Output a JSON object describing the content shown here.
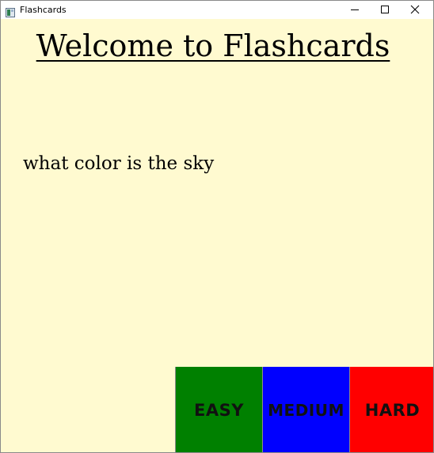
{
  "window": {
    "title": "Flashcards",
    "controls": {
      "minimize_icon": "minimize-icon",
      "maximize_icon": "maximize-icon",
      "close_icon": "close-icon"
    }
  },
  "main": {
    "heading": "Welcome to Flashcards",
    "question": "what color is the sky"
  },
  "buttons": {
    "easy": {
      "label": "EASY",
      "color": "#008000"
    },
    "medium": {
      "label": "MEDIUM",
      "color": "#0000ff"
    },
    "hard": {
      "label": "HARD",
      "color": "#ff0000"
    }
  },
  "colors": {
    "background": "#fffad0"
  }
}
